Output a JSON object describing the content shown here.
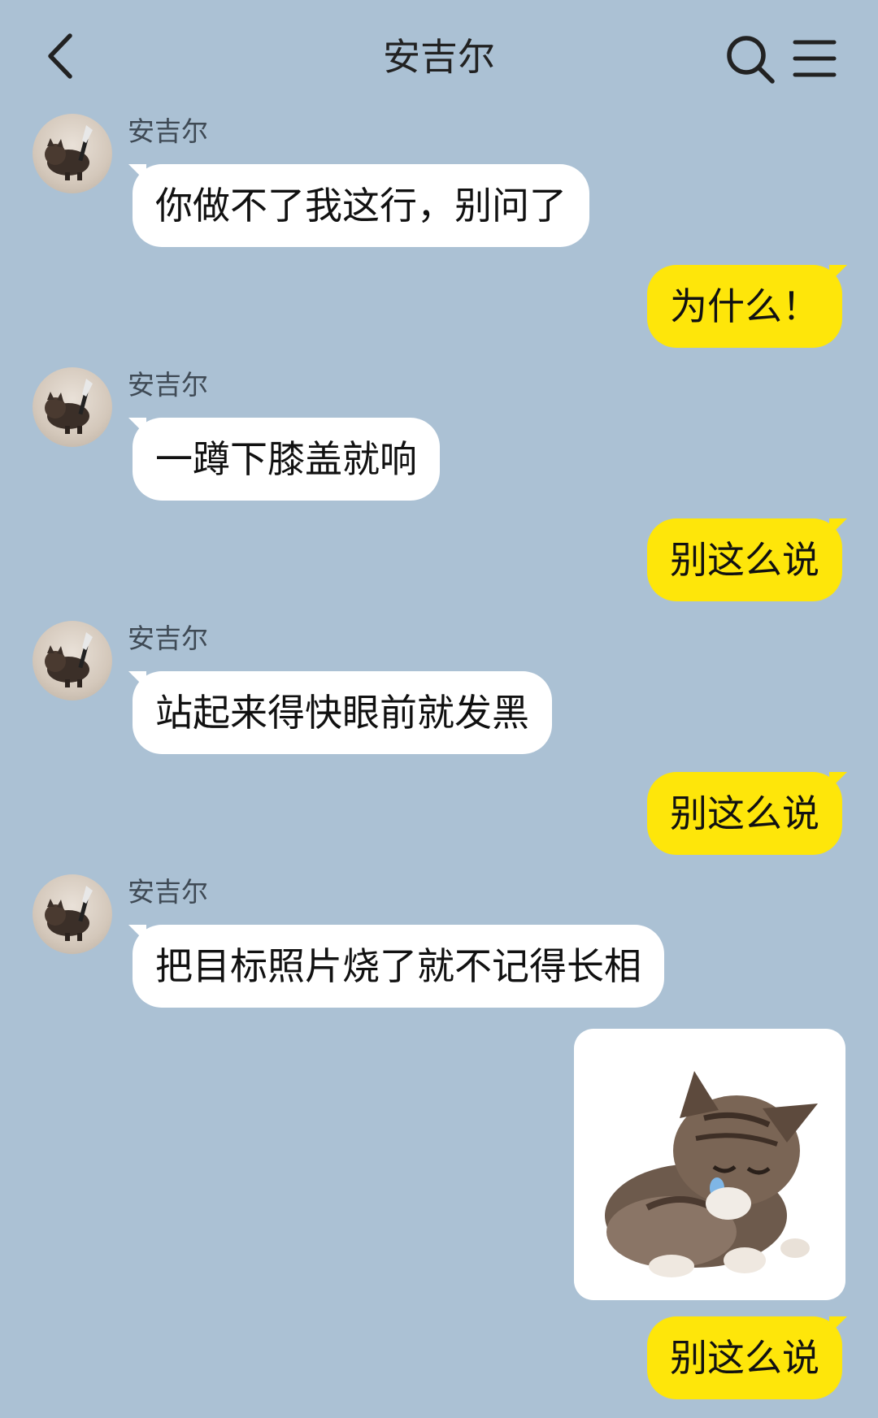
{
  "header": {
    "title": "安吉尔",
    "back_icon": "chevron-left-icon",
    "search_icon": "search-icon",
    "menu_icon": "menu-icon"
  },
  "colors": {
    "background": "#abc1d4",
    "incoming_bubble": "#ffffff",
    "outgoing_bubble": "#fee60a"
  },
  "messages": [
    {
      "direction": "incoming",
      "sender": "安吉尔",
      "text": "你做不了我这行，别问了"
    },
    {
      "direction": "outgoing",
      "text": "为什么！"
    },
    {
      "direction": "incoming",
      "sender": "安吉尔",
      "text": "一蹲下膝盖就响"
    },
    {
      "direction": "outgoing",
      "text": "别这么说"
    },
    {
      "direction": "incoming",
      "sender": "安吉尔",
      "text": "站起来得快眼前就发黑"
    },
    {
      "direction": "outgoing",
      "text": "别这么说"
    },
    {
      "direction": "incoming",
      "sender": "安吉尔",
      "text": "把目标照片烧了就不记得长相"
    },
    {
      "direction": "outgoing",
      "type": "sticker",
      "sticker": "sad-kitten-sticker"
    },
    {
      "direction": "outgoing",
      "text": "别这么说"
    }
  ]
}
